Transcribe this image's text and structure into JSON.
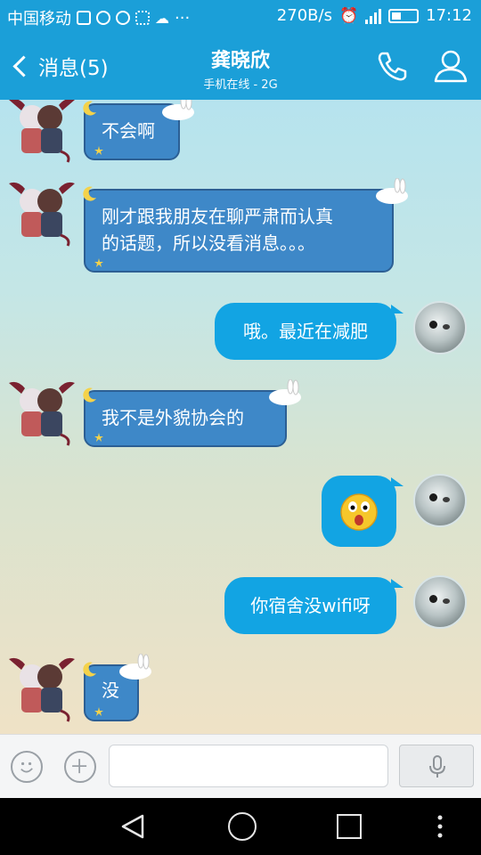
{
  "status_bar": {
    "carrier": "中国移动",
    "more": "···",
    "net_speed": "270B/s",
    "time": "17:12"
  },
  "header": {
    "back_label": "消息(5)",
    "title": "龚晓欣",
    "subtitle": "手机在线 - 2G"
  },
  "messages": [
    {
      "side": "left",
      "text": "不会啊"
    },
    {
      "side": "left",
      "text_line1": "刚才跟我朋友在聊严肃而认真",
      "text_line2": "的话题，所以没看消息。。。"
    },
    {
      "side": "right",
      "text": "哦。最近在减肥"
    },
    {
      "side": "left",
      "text": "我不是外貌协会的"
    },
    {
      "side": "right",
      "emoji": "surprised-face"
    },
    {
      "side": "right",
      "text": "你宿舍没wifi呀"
    },
    {
      "side": "left",
      "text": "没"
    }
  ],
  "input": {
    "value": "",
    "placeholder": ""
  },
  "colors": {
    "header": "#1b9fd8",
    "left_bubble": "#3e88c8",
    "right_bubble": "#12a4e3"
  }
}
